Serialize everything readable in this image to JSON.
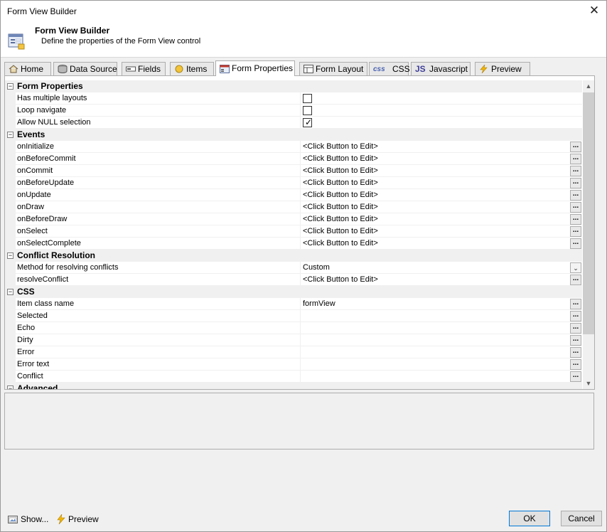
{
  "window": {
    "title": "Form View Builder",
    "close_symbol": "✕"
  },
  "header": {
    "title": "Form View Builder",
    "subtitle": "Define the properties of the Form View control"
  },
  "tabs": [
    {
      "label": "Home",
      "icon": "home-icon"
    },
    {
      "label": "Data Source",
      "icon": "database-icon"
    },
    {
      "label": "Fields",
      "icon": "fields-icon"
    },
    {
      "label": "Items",
      "icon": "items-icon"
    },
    {
      "label": "Form Properties",
      "icon": "form-properties-icon",
      "active": true
    },
    {
      "label": "Form Layout",
      "icon": "form-layout-icon"
    },
    {
      "label": "CSS",
      "icon": "css-icon"
    },
    {
      "label": "Javascript",
      "icon": "javascript-icon"
    },
    {
      "label": "Preview",
      "icon": "lightning-icon"
    }
  ],
  "grid": {
    "categories": {
      "form_properties": "Form Properties",
      "events": "Events",
      "conflict_resolution": "Conflict Resolution",
      "css": "CSS",
      "advanced": "Advanced"
    },
    "form_properties": [
      {
        "name": "Has multiple layouts",
        "checked": false
      },
      {
        "name": "Loop navigate",
        "checked": false
      },
      {
        "name": "Allow NULL selection",
        "checked": true
      }
    ],
    "events": [
      {
        "name": "onInitialize",
        "value": "<Click Button to Edit>"
      },
      {
        "name": "onBeforeCommit",
        "value": "<Click Button to Edit>"
      },
      {
        "name": "onCommit",
        "value": "<Click Button to Edit>"
      },
      {
        "name": "onBeforeUpdate",
        "value": "<Click Button to Edit>"
      },
      {
        "name": "onUpdate",
        "value": "<Click Button to Edit>"
      },
      {
        "name": "onDraw",
        "value": "<Click Button to Edit>"
      },
      {
        "name": "onBeforeDraw",
        "value": "<Click Button to Edit>"
      },
      {
        "name": "onSelect",
        "value": "<Click Button to Edit>"
      },
      {
        "name": "onSelectComplete",
        "value": "<Click Button to Edit>"
      }
    ],
    "conflict_resolution": [
      {
        "name": "Method for resolving conflicts",
        "value": "Custom",
        "editor": "dropdown"
      },
      {
        "name": "resolveConflict",
        "value": "<Click Button to Edit>",
        "editor": "button"
      }
    ],
    "css": [
      {
        "name": "Item class name",
        "value": "formView"
      },
      {
        "name": "Selected",
        "value": ""
      },
      {
        "name": "Echo",
        "value": ""
      },
      {
        "name": "Dirty",
        "value": ""
      },
      {
        "name": "Error",
        "value": ""
      },
      {
        "name": "Error text",
        "value": ""
      },
      {
        "name": "Conflict",
        "value": ""
      }
    ],
    "ellipsis": "...",
    "collapse_symbol": "−",
    "check_symbol": "✓"
  },
  "scrollbar": {
    "up": "▲",
    "down": "▼"
  },
  "footer": {
    "show_label": "Show...",
    "preview_label": "Preview",
    "ok_label": "OK",
    "cancel_label": "Cancel"
  }
}
